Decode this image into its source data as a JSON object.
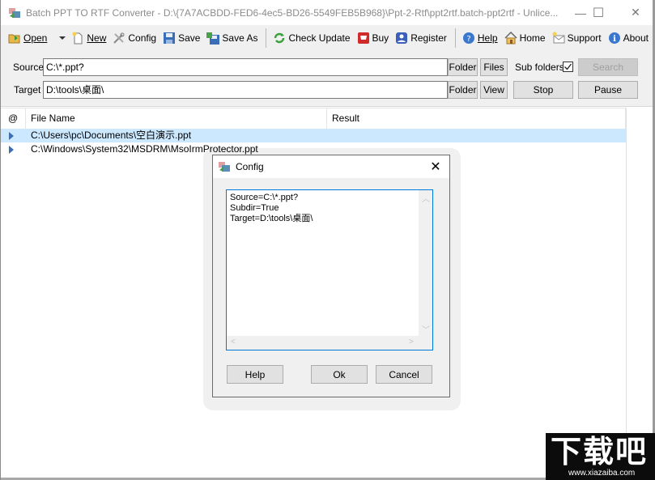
{
  "window": {
    "title": "Batch PPT TO RTF Converter - D:\\{7A7ACBDD-FED6-4ec5-BD26-5549FEB5B968}\\Ppt-2-Rtf\\ppt2rtf.batch-ppt2rtf - Unlice...",
    "minimize_glyph": "—",
    "maximize_glyph": "☐",
    "close_glyph": "✕"
  },
  "toolbar": {
    "open": "Open",
    "new": "New",
    "config": "Config",
    "save": "Save",
    "save_as": "Save As",
    "check_update": "Check Update",
    "buy": "Buy",
    "register": "Register",
    "help": "Help",
    "home": "Home",
    "support": "Support",
    "about": "About"
  },
  "form": {
    "source_label": "Source",
    "source_value": "C:\\*.ppt?",
    "target_label": "Target",
    "target_value": "D:\\tools\\桌面\\",
    "folder_label": "Folder",
    "files_label": "Files",
    "view_label": "View",
    "subfolders_label": "Sub folders",
    "subfolders_checked": true,
    "search_label": "Search",
    "stop_label": "Stop",
    "pause_label": "Pause"
  },
  "list": {
    "columns": [
      "@",
      "File Name",
      "Result"
    ],
    "rows": [
      {
        "file": "C:\\Users\\pc\\Documents\\空白演示.ppt",
        "result": "",
        "selected": true
      },
      {
        "file": "C:\\Windows\\System32\\MSDRM\\MsoIrmProtector.ppt",
        "result": "",
        "selected": false
      }
    ]
  },
  "dialog": {
    "title": "Config",
    "close_glyph": "✕",
    "content": "Source=C:\\*.ppt?\nSubdir=True\nTarget=D:\\tools\\桌面\\",
    "help_label": "Help",
    "ok_label": "Ok",
    "cancel_label": "Cancel"
  },
  "watermark": {
    "logo_text": "下载吧",
    "url": "www.xiazaiba.com"
  }
}
